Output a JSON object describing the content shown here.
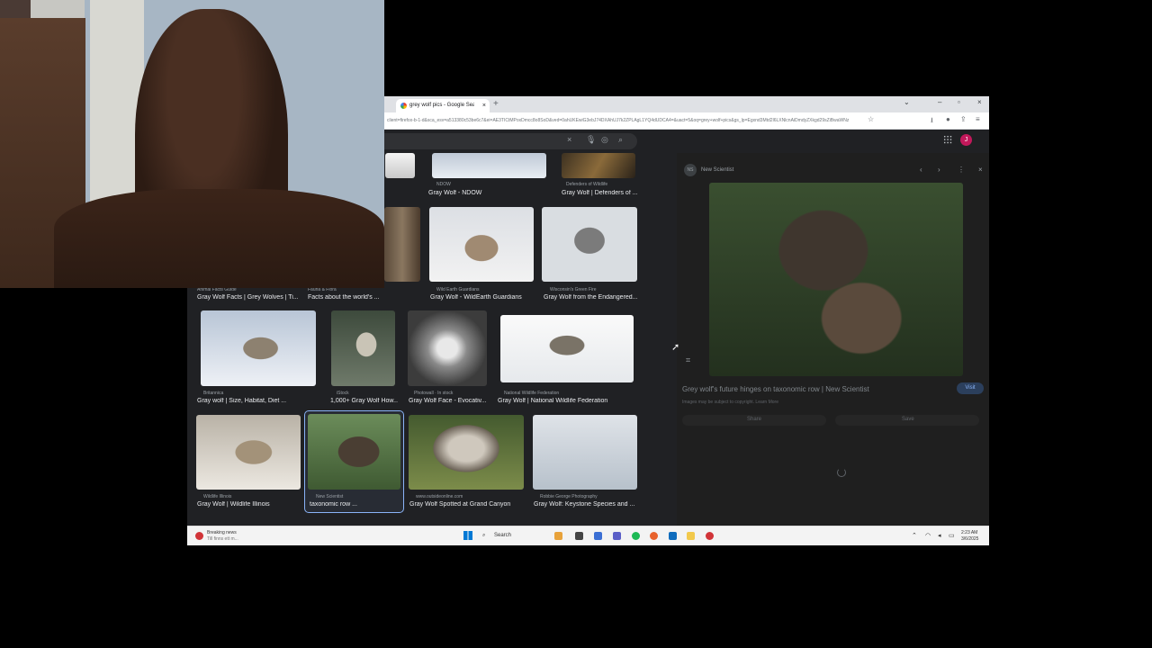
{
  "browser": {
    "tab_title": "grey wolf pics - Google Search",
    "tab_close": "×",
    "new_tab": "+",
    "url": "client=firefox-b-1-d&sca_esv=a513380c53be6c7&ei=AE3TICtMPoxDmcc8o8SoD&ved=0ahUKEwiG3ebJ74DXAhUJ7k2ZPLAgL1YQ4dUDCA4=&uact=5&oq=grey+wolf+pics&gs_lp=Egxnd3Mtd2l6LXNlcnAiDmdyZXkgd29sZiBwaWNz",
    "avatar_letter": "J",
    "controls": {
      "minimize": "–",
      "maximize": "▫",
      "close": "×",
      "chevron": "⌄"
    }
  },
  "results": [
    {
      "caption": "Gray Wolf - NDOW",
      "source": "NDOW"
    },
    {
      "caption": "Gray Wolf | Defenders of ...",
      "source": "Defenders of Wildlife"
    },
    {
      "caption": "Gray Wolf Facts | Grey Wolves | Ti...",
      "source": "Animal Facts Guide"
    },
    {
      "caption": "Facts about the world's ...",
      "source": "Fauna & Flora"
    },
    {
      "caption": "Gray Wolf - WildEarth Guardians",
      "source": "Wild Earth Guardians"
    },
    {
      "caption": "Gray Wolf from the Endangered...",
      "source": "Wisconsin's Green Fire"
    },
    {
      "caption": "Gray wolf | Size, Habitat, Diet ...",
      "source": "Britannica"
    },
    {
      "caption": "1,000+ Gray Wolf How...",
      "source": "iStock"
    },
    {
      "caption": "Gray Wolf Face - Evocativ...",
      "source": "Photowall · In stock"
    },
    {
      "caption": "Gray Wolf | National Wildlife Federation",
      "source": "National Wildlife Federation"
    },
    {
      "caption": "Gray Wolf | Wildlife Illinois",
      "source": "Wildlife Illinois"
    },
    {
      "caption": "taxonomic row ...",
      "source": "New Scientist"
    },
    {
      "caption": "Gray Wolf Spotted at Grand Canyon",
      "source": "www.outsideonline.com"
    },
    {
      "caption": "Gray Wolf: Keystone Species and ...",
      "source": "Robbie George Photography"
    }
  ],
  "panel": {
    "site_initials": "NS",
    "site_name": "New Scientist",
    "title": "Grey wolf's future hinges on taxonomic row | New Scientist",
    "visit_label": "Visit",
    "copyright": "Images may be subject to copyright. Learn More",
    "share_label": "Share",
    "save_label": "Save"
  },
  "taskbar": {
    "news_title": "Breaking news",
    "news_sub": "Till finns ett m...",
    "search_label": "Search",
    "time": "2:23 AM",
    "date": "3/6/2025"
  },
  "colors": {
    "accent": "#8ab4f8",
    "avatar": "#c2185b",
    "page_bg": "#202124"
  }
}
